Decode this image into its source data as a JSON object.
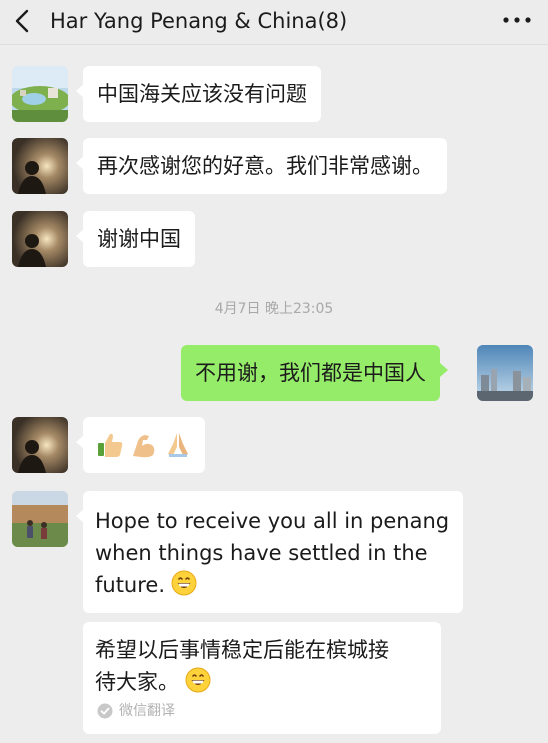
{
  "header": {
    "title": "Har Yang Penang & China(8)",
    "back_icon": "chevron-left-icon",
    "more_icon": "more-dots-icon"
  },
  "messages": [
    {
      "side": "left",
      "avatar": "park-landscape",
      "text": "中国海关应该没有问题"
    },
    {
      "side": "left",
      "avatar": "sunset-silhouette",
      "text": "再次感谢您的好意。我们非常感谢。"
    },
    {
      "side": "left",
      "avatar": "sunset-silhouette",
      "text": "谢谢中国"
    },
    {
      "side": "right",
      "avatar": "city-skyline",
      "text": "不用谢，我们都是中国人"
    },
    {
      "side": "left",
      "avatar": "sunset-silhouette",
      "emojis": [
        "thumbs-up-icon",
        "flexed-biceps-icon",
        "folded-hands-icon"
      ]
    },
    {
      "side": "left",
      "avatar": "stadium-people",
      "text_lines": [
        "Hope to receive you all in penang",
        "when things have settled in the",
        "future."
      ],
      "emoji": "grinning-face-icon"
    },
    {
      "side": "left",
      "text_lines": [
        "希望以后事情稳定后能在槟城接",
        "待大家。"
      ],
      "emoji": "grinning-face-icon",
      "translation_note": "微信翻译"
    }
  ],
  "timestamp": "4月7日 晚上23:05",
  "colors": {
    "background": "#ededed",
    "bubble_incoming": "#ffffff",
    "bubble_outgoing": "#95ec69"
  }
}
